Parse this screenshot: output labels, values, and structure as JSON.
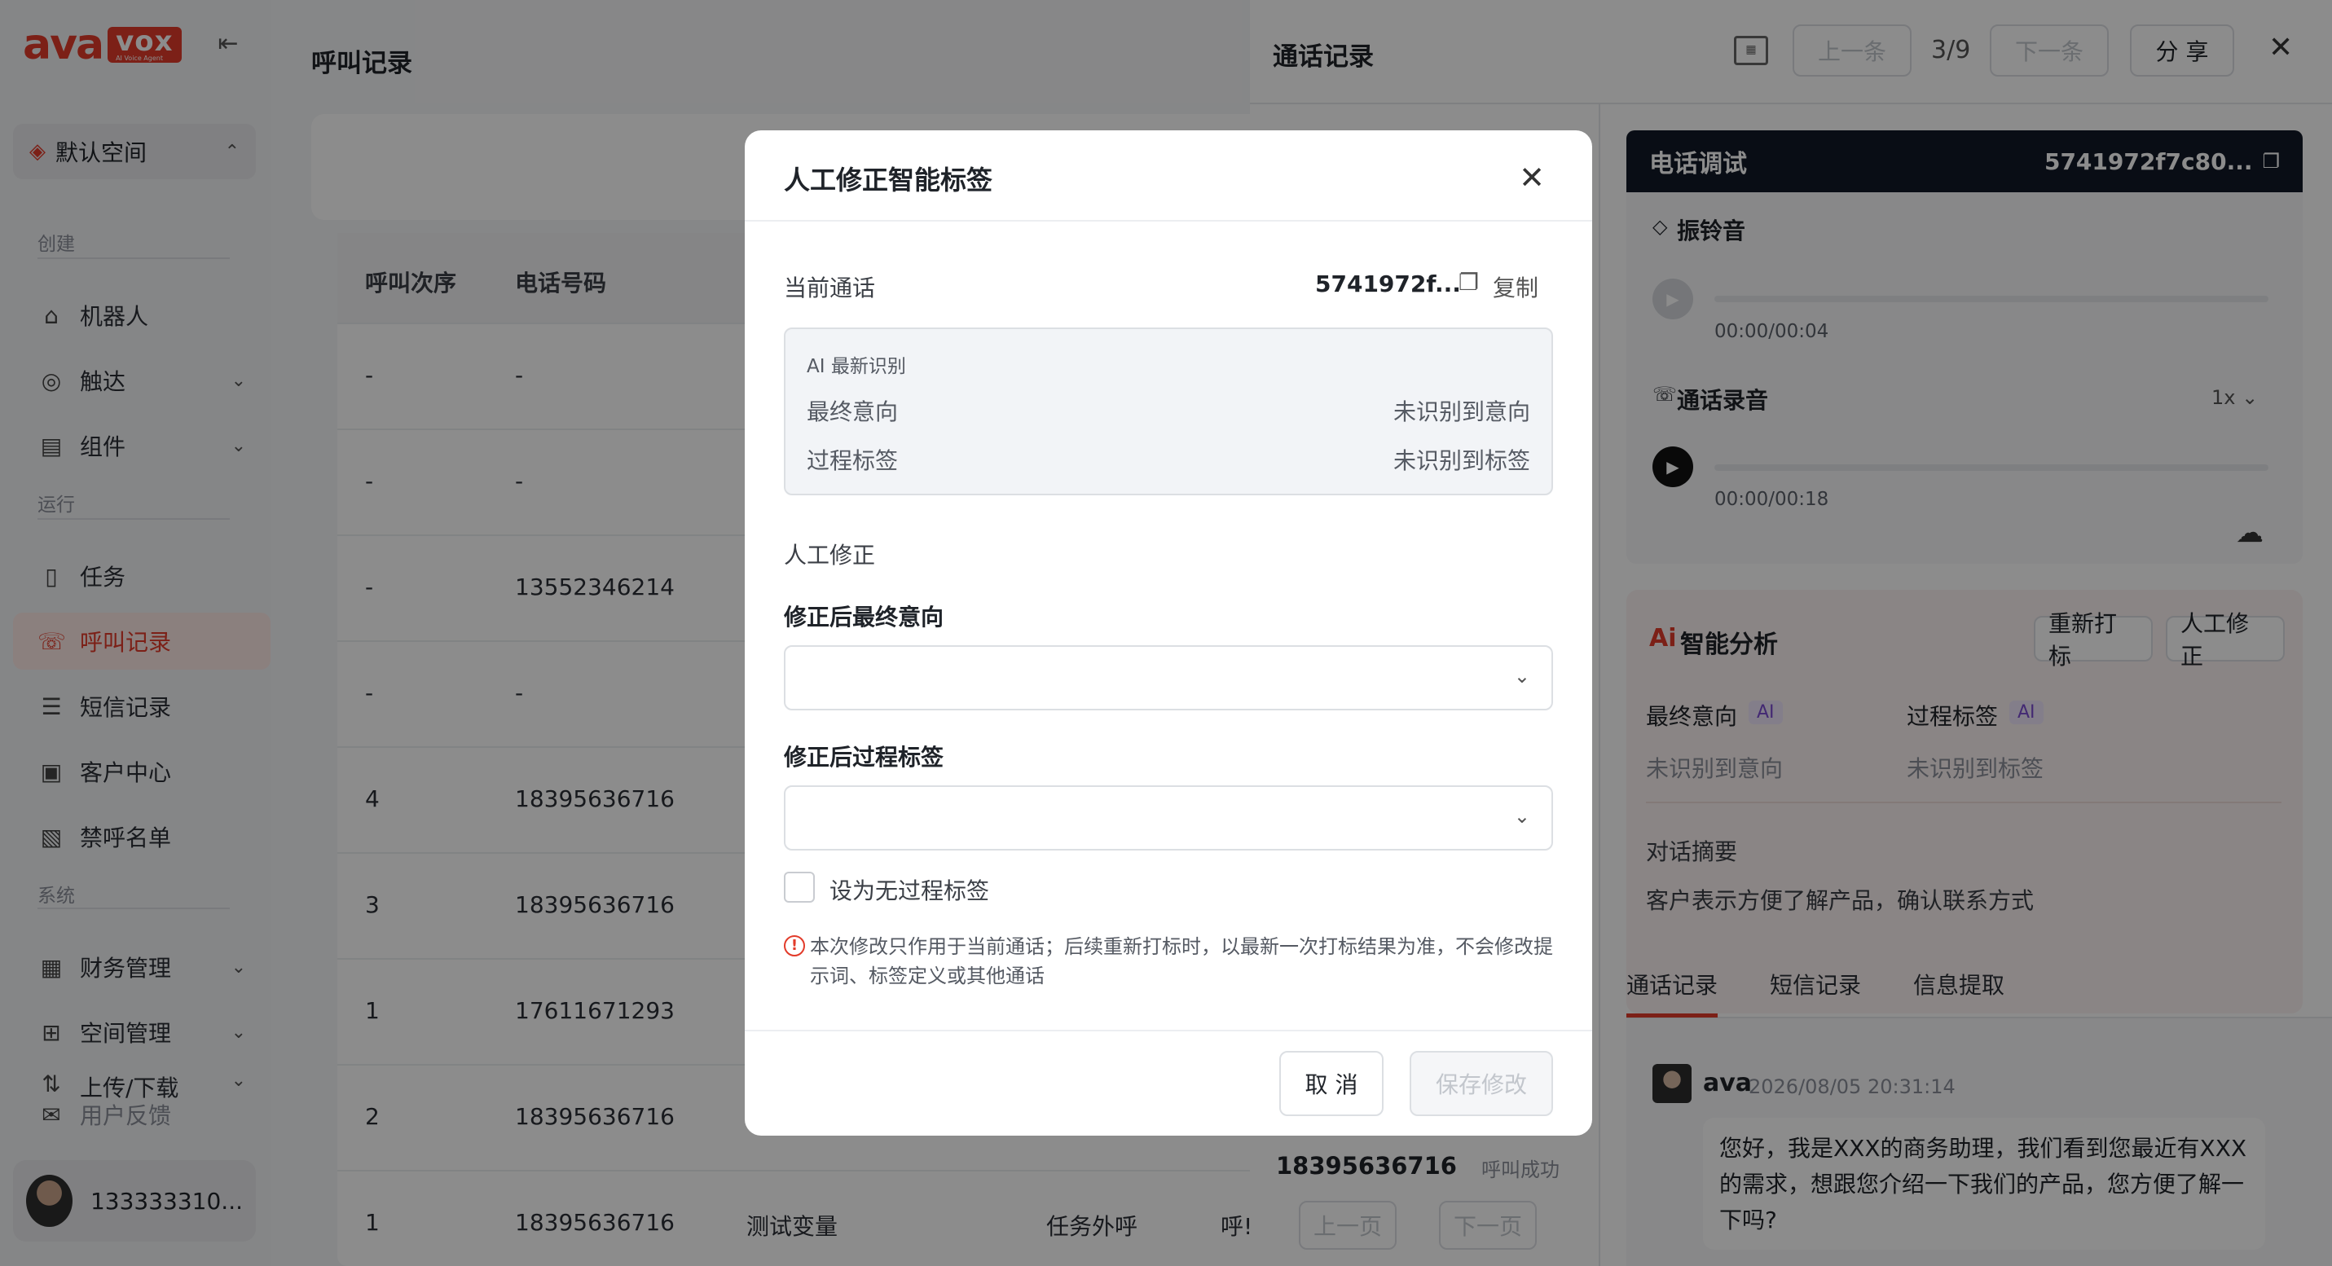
{
  "sidebar": {
    "logo_main": "ava",
    "logo_box": "vox",
    "logo_sub": "AI Voice Agent",
    "space": "默认空间",
    "section_create": "创建",
    "section_run": "运行",
    "section_system": "系统",
    "items": [
      {
        "label": "机器人",
        "icon": "robot-icon"
      },
      {
        "label": "触达",
        "icon": "reach-icon"
      },
      {
        "label": "组件",
        "icon": "component-icon"
      },
      {
        "label": "任务",
        "icon": "task-icon"
      },
      {
        "label": "呼叫记录",
        "icon": "phone-icon"
      },
      {
        "label": "短信记录",
        "icon": "message-icon"
      },
      {
        "label": "客户中心",
        "icon": "customer-icon"
      },
      {
        "label": "禁呼名单",
        "icon": "blocklist-icon"
      },
      {
        "label": "财务管理",
        "icon": "finance-icon"
      },
      {
        "label": "空间管理",
        "icon": "grid-icon"
      },
      {
        "label": "上传/下载",
        "icon": "upload-icon"
      },
      {
        "label": "用户反馈",
        "icon": "feedback-icon"
      }
    ],
    "user_name": "133333310..."
  },
  "main": {
    "title": "呼叫记录",
    "table": {
      "headers": [
        "呼叫次序",
        "电话号码"
      ],
      "rows": [
        {
          "order": "-",
          "phone": "-"
        },
        {
          "order": "-",
          "phone": "-"
        },
        {
          "order": "-",
          "phone": "13552346214"
        },
        {
          "order": "-",
          "phone": "-"
        },
        {
          "order": "4",
          "phone": "18395636716"
        },
        {
          "order": "3",
          "phone": "18395636716"
        },
        {
          "order": "1",
          "phone": "17611671293"
        },
        {
          "order": "2",
          "phone": "18395636716"
        },
        {
          "order": "1",
          "phone": "18395636716",
          "var": "测试变量",
          "type": "任务外呼",
          "extra": "呼!"
        }
      ]
    }
  },
  "drawer": {
    "title": "通话记录",
    "prev": "上一条",
    "next": "下一条",
    "counter": "3/9",
    "share": "分 享",
    "left_phone": "18395636716",
    "left_status": "呼叫成功",
    "prev_page": "上一页",
    "next_page": "下一页",
    "test_title": "电话调试",
    "test_id": "5741972f7c80...",
    "ring_label": "振铃音",
    "ring_time": "00:00/00:04",
    "record_label": "通话录音",
    "speed": "1x",
    "record_time": "00:00/00:18",
    "ai_title": "智能分析",
    "retag": "重新打标",
    "manual": "人工修正",
    "final_intent": "最终意向",
    "process_tag": "过程标签",
    "ai_badge": "AI",
    "final_intent_val": "未识别到意向",
    "process_tag_val": "未识别到标签",
    "summary_label": "对话摘要",
    "summary": "客户表示方便了解产品，确认联系方式",
    "tabs": [
      "通话记录",
      "短信记录",
      "信息提取"
    ],
    "chat_name": "ava",
    "chat_time": "2026/08/05 20:31:14",
    "chat_text": "您好，我是XXX的商务助理，我们看到您最近有XXX的需求，想跟您介绍一下我们的产品，您方便了解一下吗?"
  },
  "modal": {
    "title": "人工修正智能标签",
    "current_call": "当前通话",
    "call_id": "5741972f...",
    "copy": "复制",
    "ai_latest": "AI 最新识别",
    "final_intent": "最终意向",
    "final_intent_val": "未识别到意向",
    "process_tag": "过程标签",
    "process_tag_val": "未识别到标签",
    "manual": "人工修正",
    "field_intent": "修正后最终意向",
    "field_tag": "修正后过程标签",
    "no_tag": "设为无过程标签",
    "warning": "本次修改只作用于当前通话；后续重新打标时，以最新一次打标结果为准，不会修改提示词、标签定义或其他通话",
    "cancel": "取 消",
    "save": "保存修改"
  },
  "colors": {
    "accent": "#e23b2a",
    "dark": "#111827"
  }
}
